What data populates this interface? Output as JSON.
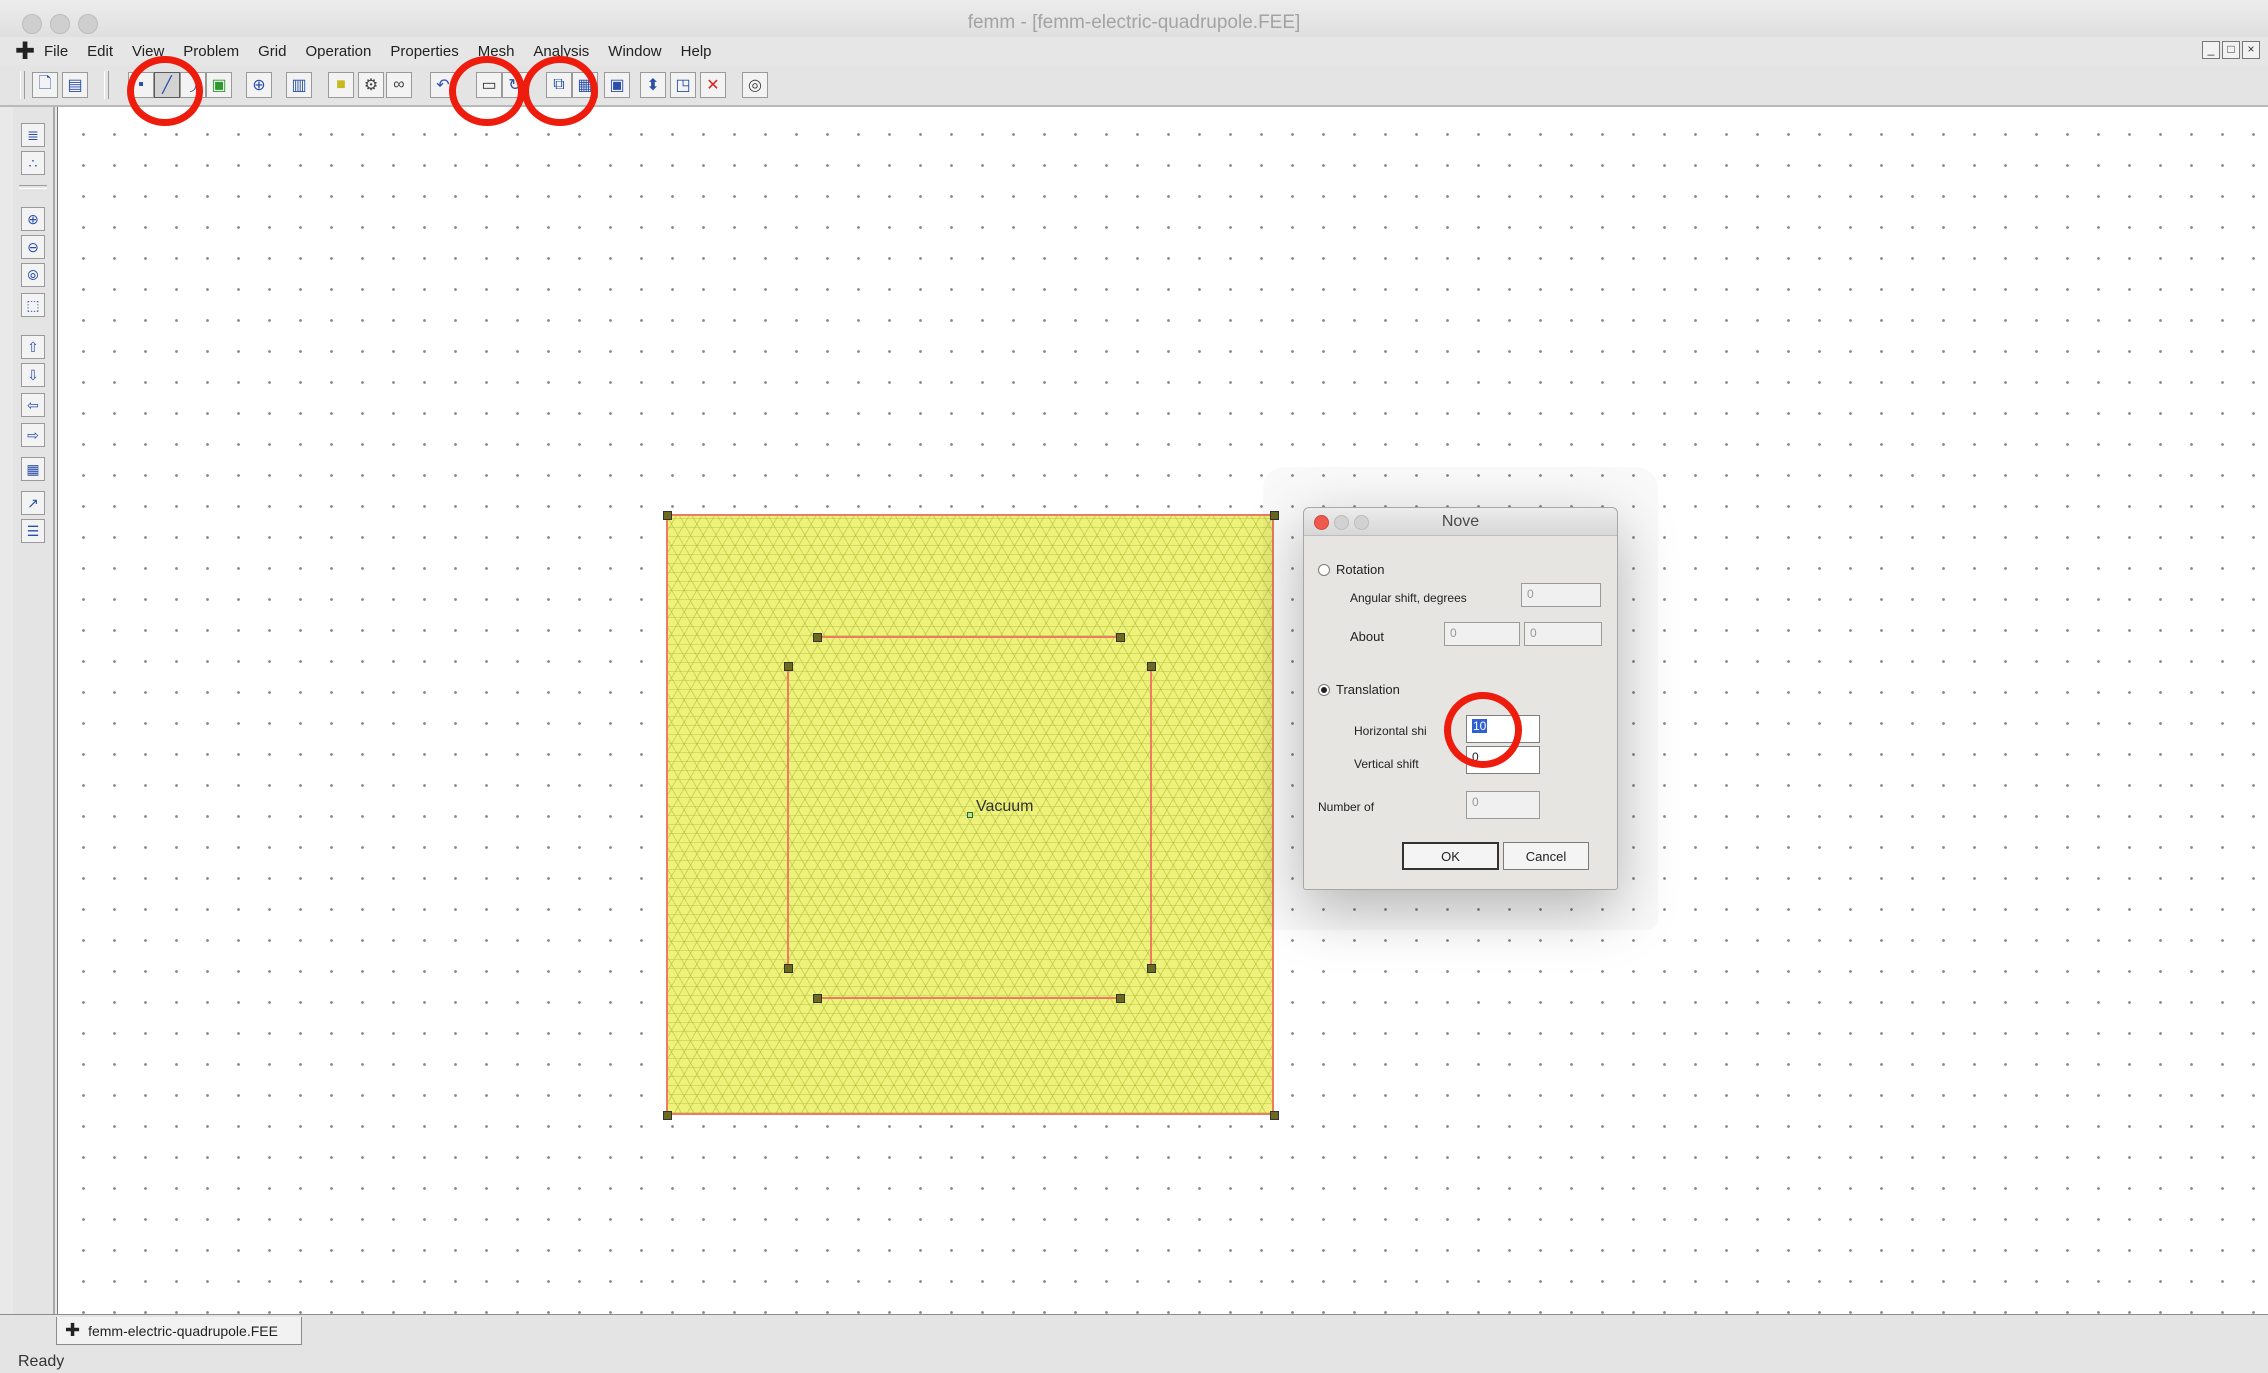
{
  "window": {
    "title": "femm - [femm-electric-quadrupole.FEE]"
  },
  "menu": {
    "items": [
      "File",
      "Edit",
      "View",
      "Problem",
      "Grid",
      "Operation",
      "Properties",
      "Mesh",
      "Analysis",
      "Window",
      "Help"
    ],
    "mdi_controls": [
      "_",
      "□",
      "×"
    ]
  },
  "canvas": {
    "region_label": "Vacuum",
    "colors": {
      "mesh_fill": "#eef17a",
      "segment": "#f07b63",
      "node": "#6b6a1d"
    }
  },
  "dialog": {
    "title": "Nove",
    "rotation_label": "Rotation",
    "angular_shift_label": "Angular shift, degrees",
    "angular_shift_value": "0",
    "about_label": "About",
    "about_x": "0",
    "about_y": "0",
    "translation_label": "Translation",
    "translation_selected": true,
    "horizontal_shift_label": "Horizontal shi",
    "horizontal_shift_value": "10",
    "vertical_shift_label": "Vertical shift",
    "vertical_shift_value": "0",
    "number_of_label": "Number of",
    "number_of_value": "0",
    "ok_label": "OK",
    "cancel_label": "Cancel"
  },
  "tab": {
    "label": "femm-electric-quadrupole.FEE"
  },
  "status": {
    "text": "Ready"
  },
  "annotation_color": "#ee1c0c"
}
